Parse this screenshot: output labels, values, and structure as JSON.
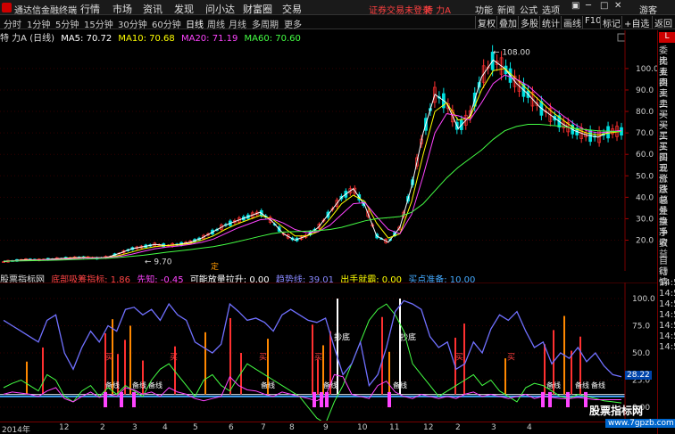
{
  "titlebar": {
    "app_title": "通达信金融终端",
    "menus": [
      "行情",
      "市场",
      "资讯",
      "发现",
      "问小达",
      "财富圈",
      "交易"
    ],
    "login_warning": "证券交易未登录",
    "stock": "特 力A",
    "tools": [
      "功能",
      "新闻",
      "公式",
      "选项"
    ],
    "guest": "游客"
  },
  "toolbar": {
    "periods": [
      "分时",
      "1分钟",
      "5分钟",
      "15分钟",
      "30分钟",
      "60分钟",
      "日线",
      "周线",
      "月线",
      "多周期",
      "更多"
    ],
    "active_period": "日线",
    "buttons": [
      "复权",
      "叠加",
      "多股",
      "统计",
      "画线",
      "F10",
      "标记",
      "+自选",
      "返回"
    ]
  },
  "ma_line": {
    "stock_label": "特 力A (日线)",
    "ma5": "MA5: 70.72",
    "ma10": "MA10: 70.68",
    "ma20": "MA20: 71.19",
    "ma60": "MA60: 70.60",
    "colors": {
      "ma5": "#ffffff",
      "ma10": "#ffff00",
      "ma20": "#ff44ff",
      "ma60": "#44ff44"
    }
  },
  "price_axis": {
    "ticks": [
      "100.0",
      "90.0",
      "80.0",
      "70.0",
      "60.0",
      "50.0",
      "40.0",
      "30.0",
      "20.0"
    ],
    "high_label": "108.00",
    "low_label": "9.70",
    "marker": "定"
  },
  "indicator": {
    "name": "股票指标网",
    "items": [
      {
        "text": "底部吸筹指标: 1.86",
        "color": "#ff4444"
      },
      {
        "text": "先知: -0.45",
        "color": "#ff44ff"
      },
      {
        "text": "可能放量拉升: 0.00",
        "color": "#ffffff"
      },
      {
        "text": "趋势线: 39.01",
        "color": "#8888ff"
      },
      {
        "text": "出手就霸: 0.00",
        "color": "#ffff00"
      },
      {
        "text": "买点准备: 10.00",
        "color": "#44aaff"
      }
    ],
    "axis_ticks": [
      "100.0",
      "75.0",
      "50.0",
      "25.0",
      "0.00"
    ],
    "current_value": "28.22",
    "labels": {
      "bottom": "抄底",
      "buy": "买",
      "ready": "备线"
    }
  },
  "dates": [
    {
      "label": "2014年"
    },
    {
      "label": "12"
    },
    {
      "label": "2"
    },
    {
      "label": "3"
    },
    {
      "label": "4"
    },
    {
      "label": "5"
    },
    {
      "label": "6"
    },
    {
      "label": "7"
    },
    {
      "label": "8"
    },
    {
      "label": "9"
    },
    {
      "label": "10"
    },
    {
      "label": "11"
    },
    {
      "label": "12"
    },
    {
      "label": "2"
    },
    {
      "label": "3"
    },
    {
      "label": "4"
    }
  ],
  "right_panel": {
    "top": "L",
    "items": [
      "委比",
      "卖五",
      "卖四",
      "卖三",
      "卖二",
      "卖一",
      "买一",
      "买二",
      "买三",
      "买四",
      "买五",
      "现价",
      "涨跌",
      "涨幅",
      "总量",
      "外盘",
      "换手",
      "净资",
      "收益",
      "自动",
      "行情",
      "14:5",
      "14:5",
      "14:5",
      "14:5",
      "14:5",
      "14:5",
      "14:5"
    ]
  },
  "watermark": {
    "title": "股票指标网",
    "url": "www.7gpzb.com"
  },
  "chart_data": {
    "type": "line",
    "title": "",
    "ylim": [
      9,
      112
    ],
    "series": [
      {
        "name": "MA5",
        "color": "#ffffff",
        "values": [
          10,
          10.5,
          11,
          10.8,
          11.2,
          11.5,
          11.8,
          12,
          11.6,
          12.2,
          14,
          16,
          17,
          18,
          17.5,
          18,
          19,
          21,
          24,
          27,
          29,
          31,
          33,
          29,
          23,
          20,
          22,
          26,
          33,
          40,
          44,
          36,
          22,
          19,
          26,
          45,
          70,
          88,
          84,
          72,
          78,
          96,
          104,
          100,
          93,
          88,
          82,
          78,
          74,
          71,
          69,
          68,
          70.7,
          70.7
        ]
      },
      {
        "name": "MA10",
        "color": "#ffff00",
        "values": [
          10.2,
          10.4,
          10.8,
          10.9,
          11,
          11.3,
          11.6,
          11.9,
          11.9,
          12,
          13,
          14.5,
          16,
          17,
          17.5,
          17.8,
          18.5,
          20,
          22,
          25,
          27.5,
          29.5,
          31.5,
          30,
          26,
          22,
          22,
          24,
          30,
          37,
          41,
          38,
          28,
          21,
          23,
          38,
          60,
          80,
          84,
          76,
          77,
          90,
          99,
          100,
          95,
          90,
          85,
          80,
          76,
          72,
          70,
          69,
          70,
          70.7
        ]
      },
      {
        "name": "MA20",
        "color": "#ff44ff",
        "values": [
          10.3,
          10.4,
          10.6,
          10.8,
          10.9,
          11.1,
          11.4,
          11.7,
          11.8,
          11.9,
          12.5,
          13.5,
          14.8,
          16,
          16.8,
          17.3,
          18,
          19,
          20.5,
          23,
          25.5,
          27.5,
          29.5,
          30,
          28,
          25,
          23.5,
          24,
          27,
          32,
          37,
          37.5,
          31,
          25,
          23,
          32,
          50,
          70,
          79,
          78,
          76,
          84,
          93,
          97,
          95,
          92,
          87,
          82,
          78,
          74,
          71,
          70,
          70.5,
          71.2
        ]
      },
      {
        "name": "MA60",
        "color": "#44ff44",
        "values": [
          10.2,
          10.3,
          10.4,
          10.5,
          10.6,
          10.8,
          11,
          11.2,
          11.4,
          11.6,
          12,
          12.5,
          13,
          13.7,
          14.4,
          15,
          15.6,
          16.3,
          17,
          18,
          19.2,
          20.5,
          21.8,
          23,
          23.8,
          24,
          24.2,
          24.5,
          25,
          26,
          27.5,
          29,
          30,
          30.5,
          31,
          33,
          37,
          43,
          49,
          54,
          58,
          62,
          67,
          71,
          73,
          74,
          74,
          73.5,
          73,
          72,
          71.5,
          71,
          70.8,
          70.6
        ]
      }
    ]
  }
}
